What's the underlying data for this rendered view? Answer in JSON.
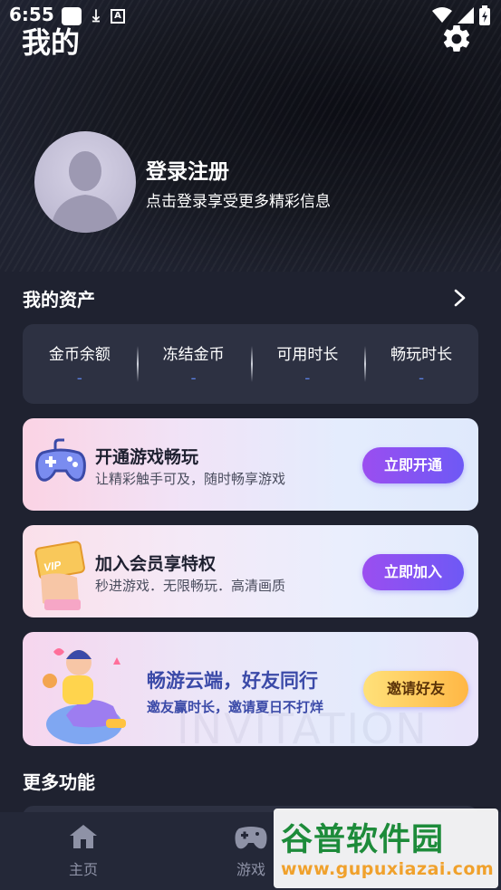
{
  "status_bar": {
    "time": "6:55",
    "a_badge": "A"
  },
  "header": {
    "title": "我的"
  },
  "profile": {
    "login_title": "登录注册",
    "login_subtitle": "点击登录享受更多精彩信息"
  },
  "assets": {
    "title": "我的资产",
    "items": [
      {
        "label": "金币余额",
        "value": "-"
      },
      {
        "label": "冻结金币",
        "value": "-"
      },
      {
        "label": "可用时长",
        "value": "-"
      },
      {
        "label": "畅玩时长",
        "value": "-"
      }
    ]
  },
  "banners": [
    {
      "title": "开通游戏畅玩",
      "subtitle": "让精彩触手可及，随时畅享游戏",
      "button": "立即开通"
    },
    {
      "title": "加入会员享特权",
      "subtitle": "秒进游戏．无限畅玩．高清画质",
      "button": "立即加入",
      "card_text": "VIP"
    },
    {
      "title": "畅游云端，好友同行",
      "subtitle": "邀友赢时长，邀请夏日不打烊",
      "button": "邀请好友",
      "watermark": "INVITATION"
    }
  ],
  "more": {
    "title": "更多功能"
  },
  "tabbar": {
    "items": [
      {
        "label": "主页",
        "icon": "home-icon"
      },
      {
        "label": "游戏",
        "icon": "gamepad-icon"
      }
    ]
  },
  "watermark": {
    "main": "谷普软件园",
    "url": "www.gupuxiazai.com"
  },
  "colors": {
    "background": "#1f2230",
    "card": "#2d3142",
    "accent_purple": "#8a52f2",
    "accent_yellow": "#ffc85a",
    "asset_value": "#5b7fe0"
  }
}
